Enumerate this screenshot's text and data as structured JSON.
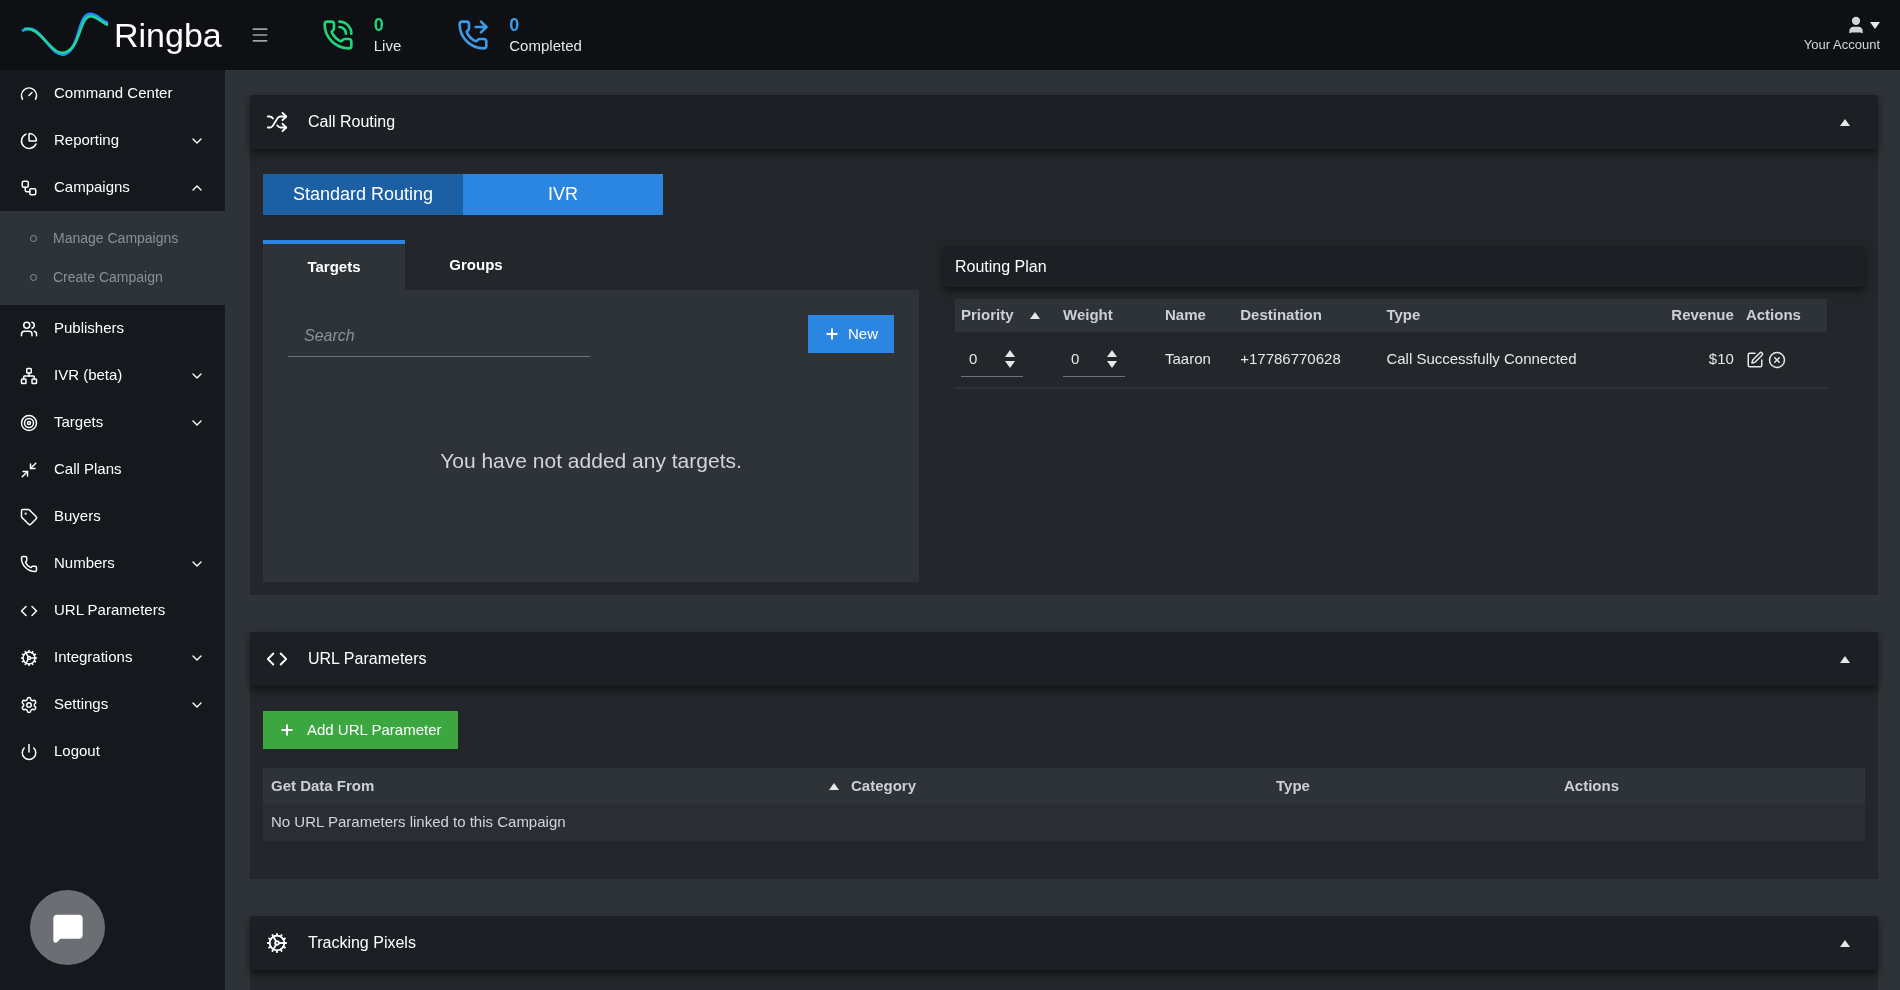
{
  "header": {
    "brand": "Ringba",
    "live": {
      "count": "0",
      "label": "Live"
    },
    "completed": {
      "count": "0",
      "label": "Completed"
    },
    "account": "Your Account"
  },
  "sidebar": {
    "items": [
      {
        "label": "Command Center",
        "kind": "link"
      },
      {
        "label": "Reporting",
        "kind": "group",
        "expanded": false
      },
      {
        "label": "Campaigns",
        "kind": "group",
        "expanded": true,
        "children": [
          {
            "label": "Manage Campaigns"
          },
          {
            "label": "Create Campaign"
          }
        ]
      },
      {
        "label": "Publishers",
        "kind": "link"
      },
      {
        "label": "IVR (beta)",
        "kind": "group",
        "expanded": false
      },
      {
        "label": "Targets",
        "kind": "group",
        "expanded": false
      },
      {
        "label": "Call Plans",
        "kind": "link"
      },
      {
        "label": "Buyers",
        "kind": "link"
      },
      {
        "label": "Numbers",
        "kind": "group",
        "expanded": false
      },
      {
        "label": "URL Parameters",
        "kind": "link"
      },
      {
        "label": "Integrations",
        "kind": "group",
        "expanded": false
      },
      {
        "label": "Settings",
        "kind": "group",
        "expanded": false
      },
      {
        "label": "Logout",
        "kind": "link"
      }
    ]
  },
  "call_routing": {
    "title": "Call Routing",
    "expanded": true,
    "modes": [
      {
        "label": "Standard Routing",
        "selected": true
      },
      {
        "label": "IVR",
        "selected": false
      }
    ],
    "tabs": [
      {
        "label": "Targets",
        "selected": true
      },
      {
        "label": "Groups",
        "selected": false
      }
    ],
    "search": {
      "placeholder": "Search"
    },
    "new_button": "New",
    "empty_message": "You have not added any targets.",
    "routing_plan": {
      "title": "Routing Plan",
      "columns": [
        {
          "label": "Priority",
          "sorted": true
        },
        {
          "label": "Weight",
          "sorted": false
        },
        {
          "label": "Name",
          "sorted": false
        },
        {
          "label": "Destination",
          "sorted": false
        },
        {
          "label": "Type",
          "sorted": false
        },
        {
          "label": "Revenue",
          "sorted": false
        },
        {
          "label": "Actions",
          "sorted": false
        }
      ],
      "rows": [
        {
          "priority": "0",
          "weight": "0",
          "name": "Taaron",
          "destination": "+17786770628",
          "type": "Call Successfully Connected",
          "revenue": "$10"
        }
      ]
    }
  },
  "url_parameters": {
    "title": "URL Parameters",
    "expanded": true,
    "add_button": "Add URL Parameter",
    "columns": [
      {
        "label": "Get Data From",
        "sorted": true
      },
      {
        "label": "Category",
        "sorted": false
      },
      {
        "label": "Type",
        "sorted": false
      },
      {
        "label": "Actions",
        "sorted": false
      }
    ],
    "empty_message": "No URL Parameters linked to this Campaign"
  },
  "tracking_pixels": {
    "title": "Tracking Pixels",
    "expanded": true
  }
}
